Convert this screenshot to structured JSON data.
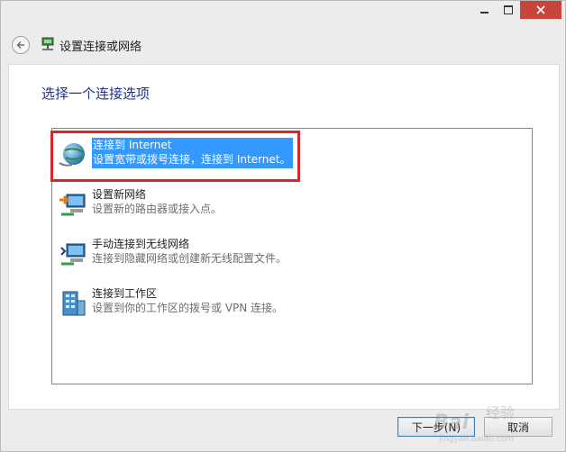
{
  "window": {
    "title": "设置连接或网络",
    "caption_buttons": [
      "minimize",
      "maximize",
      "close"
    ]
  },
  "page": {
    "heading": "选择一个连接选项"
  },
  "options": [
    {
      "title": "连接到 Internet",
      "description": "设置宽带或拨号连接，连接到 Internet。",
      "icon": "globe-icon",
      "selected": true
    },
    {
      "title": "设置新网络",
      "description": "设置新的路由器或接入点。",
      "icon": "new-network-icon",
      "selected": false
    },
    {
      "title": "手动连接到无线网络",
      "description": "连接到隐藏网络或创建新无线配置文件。",
      "icon": "wireless-network-icon",
      "selected": false
    },
    {
      "title": "连接到工作区",
      "description": "设置到你的工作区的拨号或 VPN 连接。",
      "icon": "workplace-icon",
      "selected": false
    }
  ],
  "buttons": {
    "next": "下一步(N)",
    "cancel": "取消"
  },
  "colors": {
    "selection": "#3399ff",
    "heading": "#1e3287",
    "close": "#c7453b",
    "annotation": "#d9262b"
  },
  "watermark": {
    "brand": "Bai",
    "sub": "经验",
    "url": "jingyan.baidu.com"
  }
}
